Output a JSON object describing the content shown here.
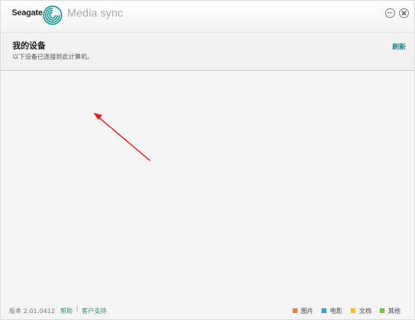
{
  "titlebar": {
    "brand": "Seagate",
    "app_title": "Media sync"
  },
  "devices": {
    "title": "我的设备",
    "subtitle": "以下设备已连接到此计算机。",
    "refresh_label": "刷新"
  },
  "footer": {
    "version": "版本 2.01.0412",
    "help_label": "帮助",
    "separator": "|",
    "support_label": "客户支持",
    "legend": [
      {
        "label": "图片",
        "color": "#e8833a"
      },
      {
        "label": "电影",
        "color": "#3aa0d8"
      },
      {
        "label": "文档",
        "color": "#f0c030"
      },
      {
        "label": "其他",
        "color": "#7cc23a"
      }
    ]
  },
  "colors": {
    "accent": "#2a8a8a",
    "arrow": "#e02020"
  }
}
